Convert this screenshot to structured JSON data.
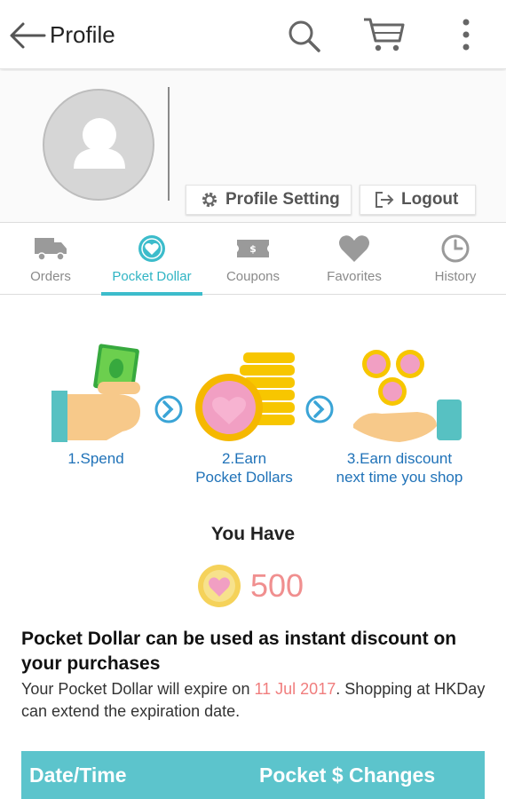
{
  "appbar": {
    "title": "Profile",
    "icons": [
      "back-arrow-icon",
      "search-icon",
      "cart-icon",
      "more-vert-icon"
    ]
  },
  "profile": {
    "setting_label": "Profile Setting",
    "logout_label": "Logout"
  },
  "tabs": [
    {
      "label": "Orders",
      "icon": "truck-icon",
      "active": false
    },
    {
      "label": "Pocket Dollar",
      "icon": "heart-coin-icon",
      "active": true
    },
    {
      "label": "Coupons",
      "icon": "ticket-icon",
      "active": false
    },
    {
      "label": "Favorites",
      "icon": "heart-icon",
      "active": false
    },
    {
      "label": "History",
      "icon": "clock-icon",
      "active": false
    }
  ],
  "steps": [
    {
      "line1": "1.Spend",
      "line2": ""
    },
    {
      "line1": "2.Earn",
      "line2": "Pocket Dollars"
    },
    {
      "line1": "3.Earn discount",
      "line2": "next time you shop"
    }
  ],
  "balance": {
    "heading": "You Have",
    "amount": "500"
  },
  "info": {
    "title": "Pocket Dollar can be used as instant discount on your purchases",
    "text_before": "Your Pocket Dollar will expire on ",
    "expiry_date": "11 Jul 2017",
    "text_after": ". Shopping at HKDay can extend the expiration date."
  },
  "table": {
    "col_datetime": "Date/Time",
    "col_changes": "Pocket $ Changes"
  },
  "colors": {
    "accent": "#3cbccb",
    "step_text": "#1f72b8",
    "amount": "#f08f8f",
    "coin": "#f7c600",
    "heart": "#f19fc3"
  }
}
